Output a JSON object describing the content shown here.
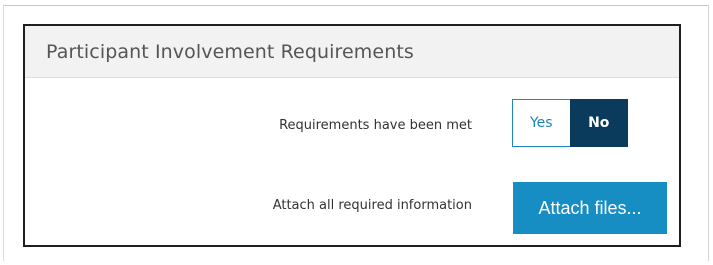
{
  "panel": {
    "title": "Participant Involvement Requirements"
  },
  "requirements_row": {
    "label": "Requirements have been met",
    "options": [
      {
        "label": "Yes",
        "selected": false
      },
      {
        "label": "No",
        "selected": true
      }
    ]
  },
  "attach_row": {
    "label": "Attach all required information",
    "button_label": "Attach files..."
  },
  "colors": {
    "accent": "#168ec4",
    "selected_toggle": "#0b3b5c",
    "header_bg": "#f2f2f2"
  }
}
